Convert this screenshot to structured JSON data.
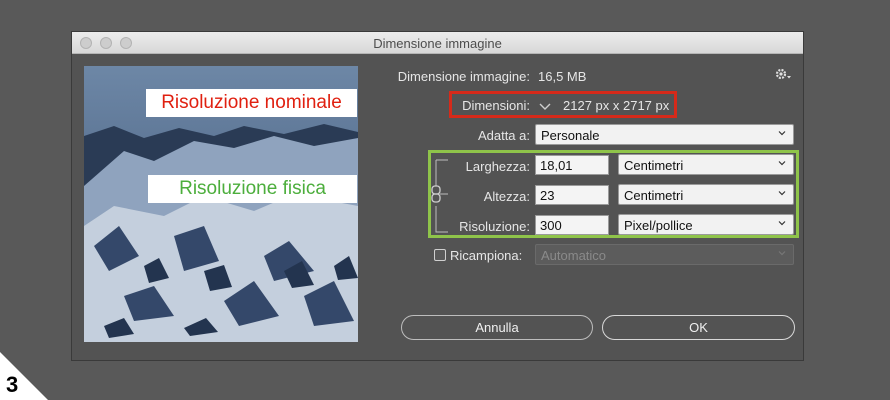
{
  "window": {
    "title": "Dimensione immagine"
  },
  "annotations": {
    "nominal": "Risoluzione nominale",
    "physical": "Risoluzione fisica"
  },
  "image_size": {
    "label": "Dimensione immagine:",
    "value": "16,5 MB"
  },
  "dimensions": {
    "label": "Dimensioni:",
    "value": "2127 px  x  2717 px"
  },
  "fit_to": {
    "label": "Adatta a:",
    "value": "Personale"
  },
  "width": {
    "label": "Larghezza:",
    "value": "18,01",
    "unit": "Centimetri"
  },
  "height": {
    "label": "Altezza:",
    "value": "23",
    "unit": "Centimetri"
  },
  "resolution": {
    "label": "Risoluzione:",
    "value": "300",
    "unit": "Pixel/pollice"
  },
  "resample": {
    "label": "Ricampiona:",
    "value": "Automatico",
    "checked": false
  },
  "buttons": {
    "cancel": "Annulla",
    "ok": "OK"
  },
  "page_number": "3",
  "colors": {
    "highlight_red": "#d62a1a",
    "highlight_green": "#8fc44a",
    "dialog_bg": "#535353"
  }
}
